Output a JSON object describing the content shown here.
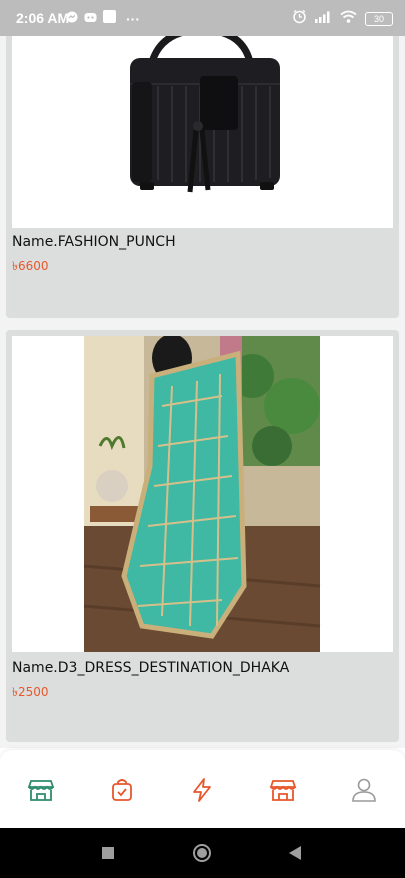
{
  "status_bar": {
    "time": "2:06 AM",
    "dots": "···",
    "battery": "30",
    "left_icons": [
      "messenger-icon",
      "discord-icon",
      "square-notification-icon"
    ],
    "right_icons": [
      "alarm-icon",
      "signal-icon",
      "wifi-icon",
      "battery-icon"
    ]
  },
  "products": [
    {
      "name": "Name.FASHION_PUNCH",
      "price": "৳6600",
      "image": "black-handbag-image"
    },
    {
      "name": "Name.D3_DRESS_DESTINATION_DHAKA",
      "price": "৳2500",
      "image": "teal-dupatta-image"
    }
  ],
  "bottom_nav": {
    "items": [
      {
        "icon": "store-icon",
        "color": "#2d8c6e"
      },
      {
        "icon": "shopping-bag-check-icon",
        "color": "#e8572b"
      },
      {
        "icon": "lightning-icon",
        "color": "#e8572b"
      },
      {
        "icon": "shop-icon",
        "color": "#e8572b"
      },
      {
        "icon": "user-icon",
        "color": "#9a9a9a"
      }
    ]
  },
  "colors": {
    "accent": "#e8572b",
    "active": "#2d8c6e",
    "card_bg": "#dcdede"
  }
}
